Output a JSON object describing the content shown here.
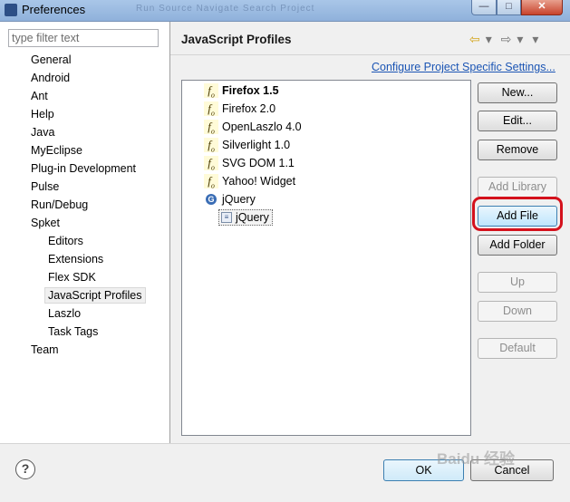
{
  "window": {
    "title": "Preferences",
    "ghost_menu": "Run  Source  Navigate  Search  Project"
  },
  "window_buttons": {
    "minimize": "—",
    "maximize": "□",
    "close": "✕"
  },
  "filter": {
    "placeholder": "type filter text"
  },
  "tree": [
    {
      "label": "General",
      "level": 0
    },
    {
      "label": "Android",
      "level": 0
    },
    {
      "label": "Ant",
      "level": 0
    },
    {
      "label": "Help",
      "level": 0
    },
    {
      "label": "Java",
      "level": 0
    },
    {
      "label": "MyEclipse",
      "level": 0
    },
    {
      "label": "Plug-in Development",
      "level": 0
    },
    {
      "label": "Pulse",
      "level": 0
    },
    {
      "label": "Run/Debug",
      "level": 0
    },
    {
      "label": "Spket",
      "level": 0
    },
    {
      "label": "Editors",
      "level": 1
    },
    {
      "label": "Extensions",
      "level": 1
    },
    {
      "label": "Flex SDK",
      "level": 1
    },
    {
      "label": "JavaScript Profiles",
      "level": 1,
      "selected": true
    },
    {
      "label": "Laszlo",
      "level": 1
    },
    {
      "label": "Task Tags",
      "level": 1
    },
    {
      "label": "Team",
      "level": 0
    }
  ],
  "page": {
    "title": "JavaScript Profiles",
    "configure_link": "Configure Project Specific Settings..."
  },
  "profiles": [
    {
      "label": "Firefox 1.5",
      "icon": "fo-profile-icon",
      "bold": true
    },
    {
      "label": "Firefox 2.0",
      "icon": "fo-profile-icon"
    },
    {
      "label": "OpenLaszlo 4.0",
      "icon": "fo-profile-icon"
    },
    {
      "label": "Silverlight 1.0",
      "icon": "fo-profile-icon"
    },
    {
      "label": "SVG DOM 1.1",
      "icon": "fo-profile-icon"
    },
    {
      "label": "Yahoo! Widget",
      "icon": "fo-profile-icon"
    },
    {
      "label": "jQuery",
      "icon": "library-icon"
    },
    {
      "label": "jQuery",
      "icon": "file-icon",
      "child": true,
      "selected": true
    }
  ],
  "buttons": {
    "new": "New...",
    "edit": "Edit...",
    "remove": "Remove",
    "add_library": "Add Library",
    "add_file": "Add File",
    "add_folder": "Add Folder",
    "up": "Up",
    "down": "Down",
    "default": "Default"
  },
  "footer": {
    "ok": "OK",
    "cancel": "Cancel",
    "help": "?",
    "watermark": "Baidu 经验"
  },
  "colors": {
    "highlight_ring": "#d4111c",
    "link": "#1b55b4"
  }
}
